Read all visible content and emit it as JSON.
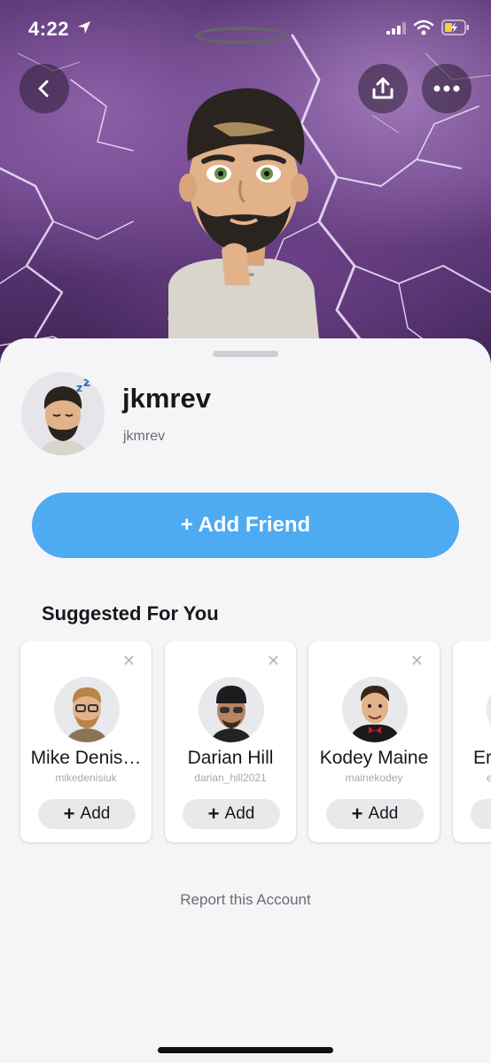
{
  "status_bar": {
    "time": "4:22"
  },
  "profile": {
    "display_name": "jkmrev",
    "username": "jkmrev",
    "add_friend_label": "+ Add Friend"
  },
  "suggested": {
    "title": "Suggested For You",
    "cards": [
      {
        "name": "Mike Denis…",
        "handle": "mikedenisiuk",
        "add_label": "Add"
      },
      {
        "name": "Darian Hill",
        "handle": "darian_hill2021",
        "add_label": "Add"
      },
      {
        "name": "Kodey Maine",
        "handle": "mainekodey",
        "add_label": "Add"
      },
      {
        "name": "Er",
        "handle": "e",
        "add_label": ""
      }
    ]
  },
  "report_label": "Report this Account",
  "icons": {
    "back": "chevron-left-icon",
    "share": "share-icon",
    "more": "more-horizontal-icon",
    "close": "close-icon",
    "plus": "plus-icon"
  },
  "colors": {
    "accent": "#4eaaf1",
    "sheet_bg": "#f5f5f7",
    "hero_purple": "#6b4288"
  }
}
